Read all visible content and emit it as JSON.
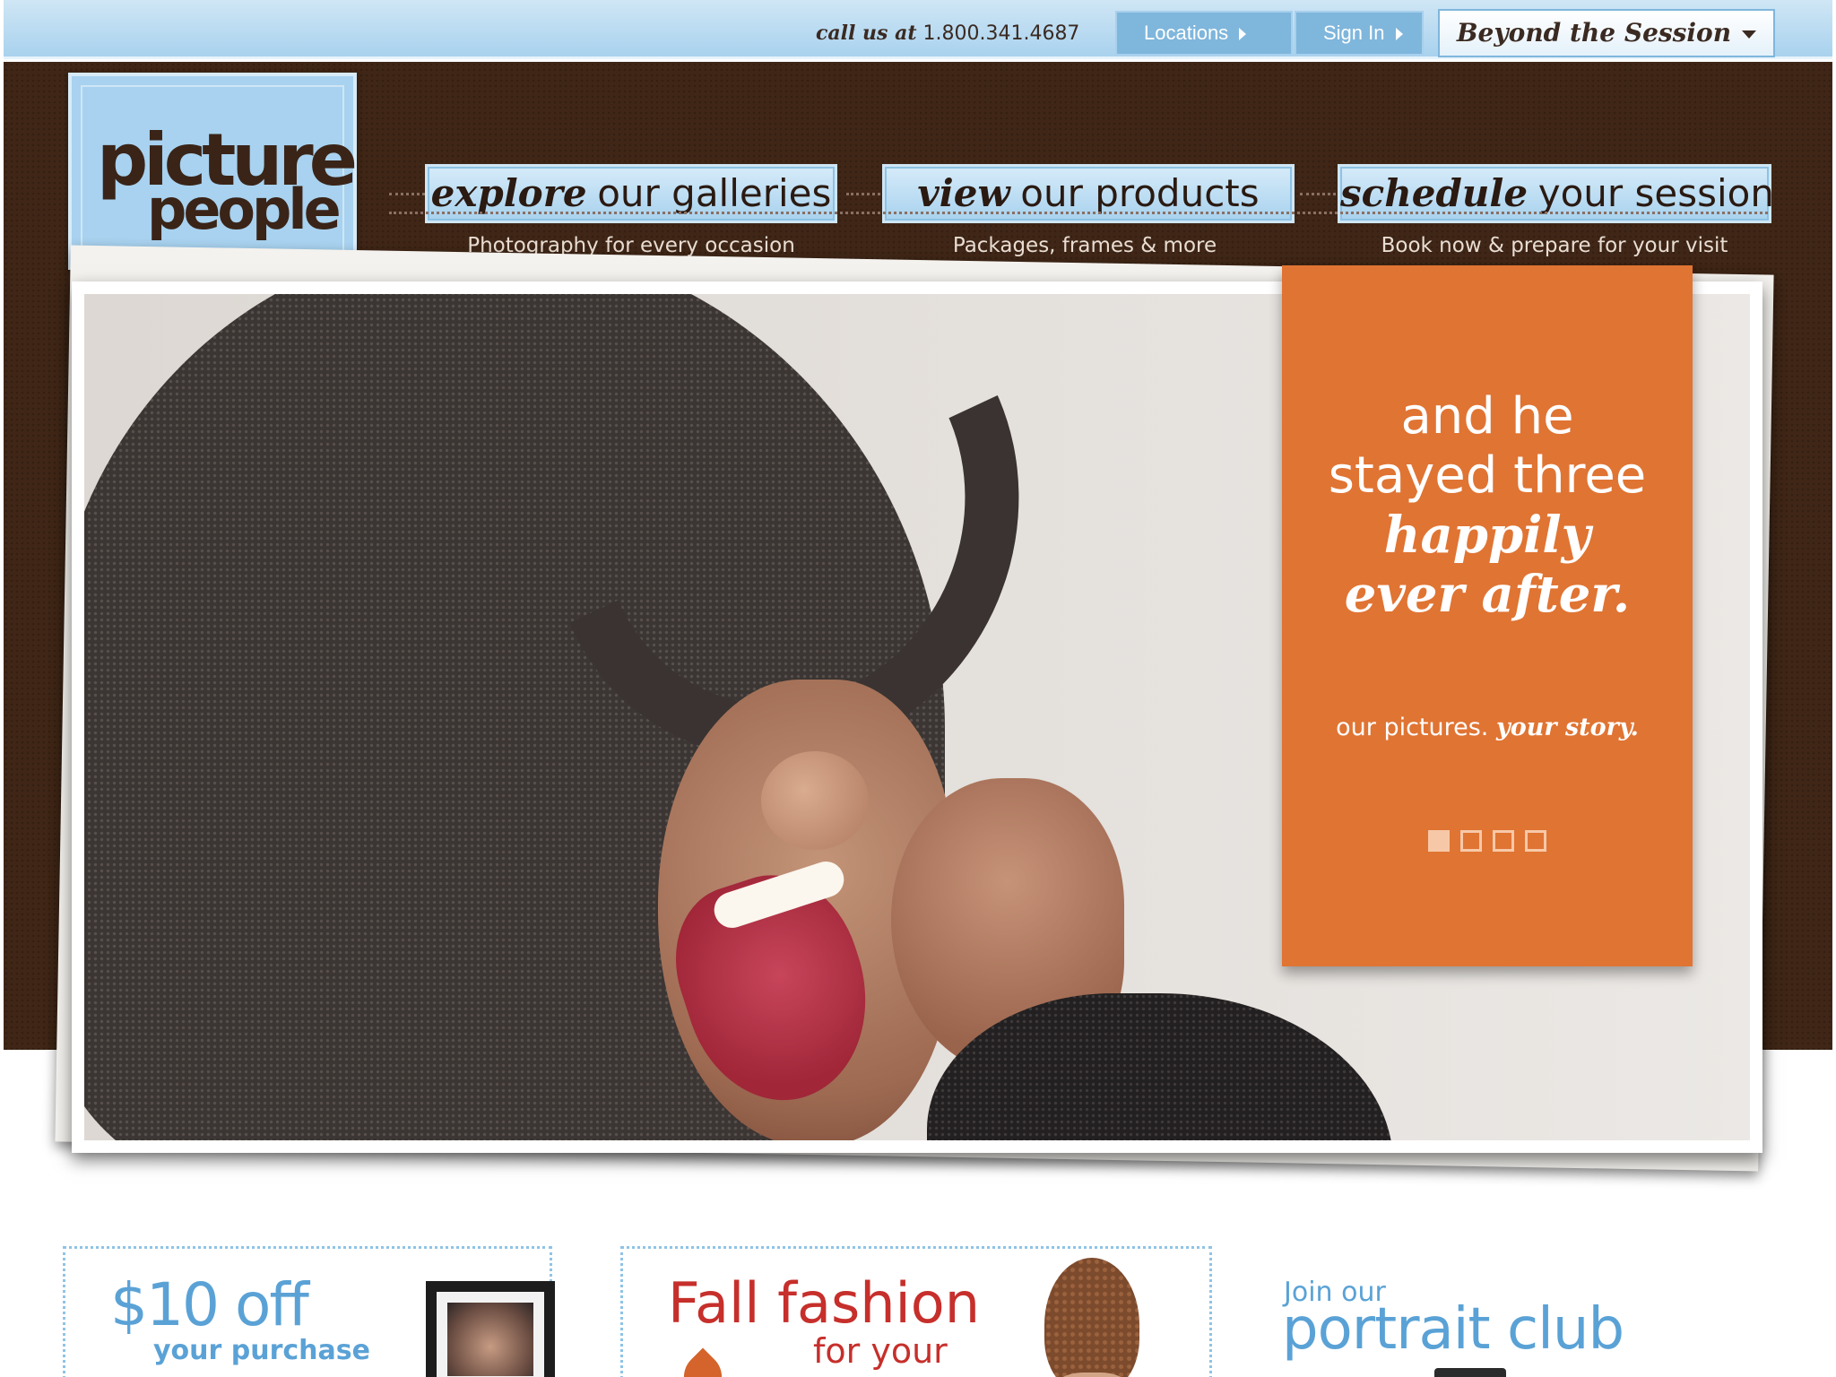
{
  "topbar": {
    "call_prefix": "call us at",
    "phone": "1.800.341.4687",
    "locations_label": "Locations",
    "signin_label": "Sign In",
    "beyond_label": "Beyond the Session"
  },
  "logo": {
    "line1": "picture",
    "line2": "people"
  },
  "nav": [
    {
      "em": "explore",
      "rest": "our galleries",
      "sub": "Photography for every occasion"
    },
    {
      "em": "view",
      "rest": "our products",
      "sub": "Packages, frames & more"
    },
    {
      "em": "schedule",
      "rest": "your session",
      "sub": "Book now & prepare for your visit"
    }
  ],
  "hero": {
    "line1": "and he",
    "line2": "stayed three",
    "line3": "happily",
    "line4": "ever after.",
    "tagline_plain": "our pictures.",
    "tagline_em": "your story.",
    "slide_count": 4,
    "active_slide": 1
  },
  "promos": {
    "off_big": "$10 off",
    "off_small": "your purchase",
    "fall_title": "Fall fashion",
    "fall_sub": "for your",
    "club_small": "Join our",
    "club_big": "portrait club"
  },
  "colors": {
    "brown": "#3f2616",
    "sky": "#a8d2ef",
    "orange": "#e07433",
    "blue_text": "#5aa2d6",
    "red_text": "#c62f2b"
  }
}
